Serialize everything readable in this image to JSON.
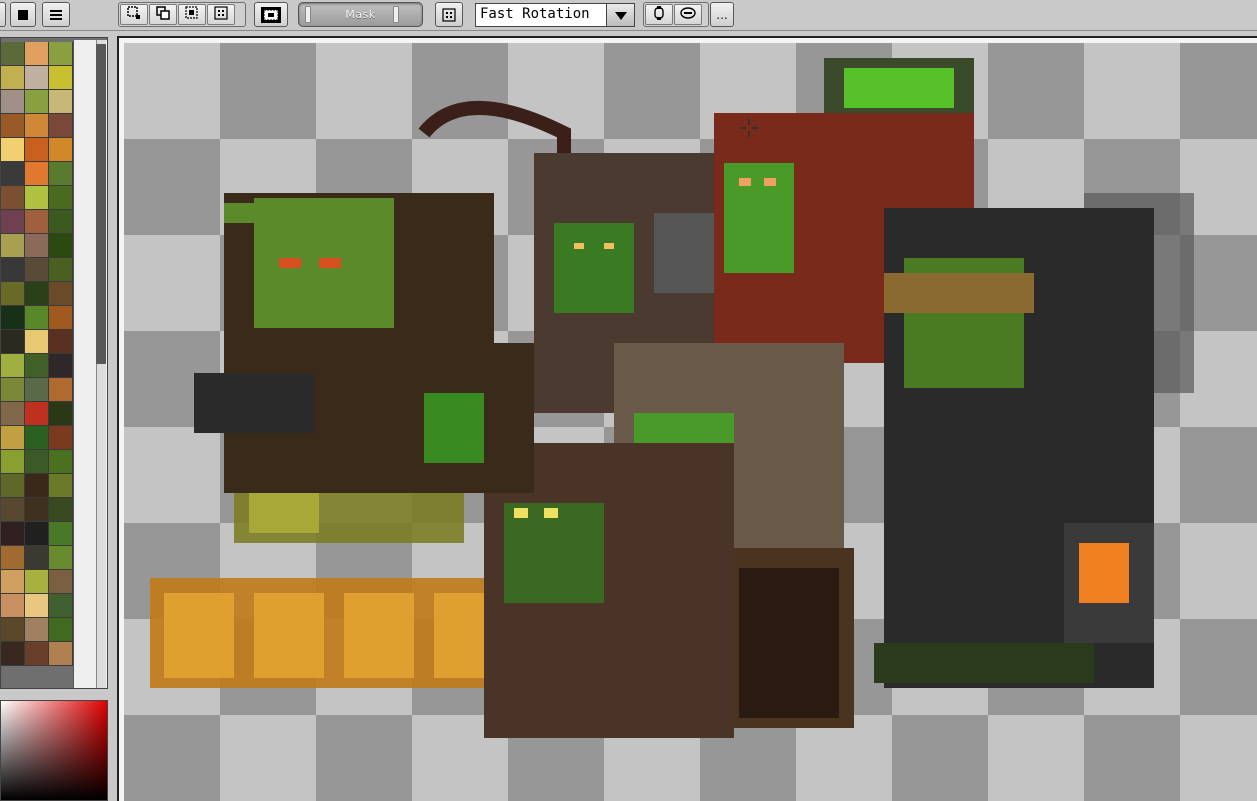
{
  "toolbar": {
    "mask_label": "Mask",
    "rotation_mode": "Fast Rotation",
    "more_label": "...",
    "icons": [
      "square-solid-icon",
      "list-icon",
      "select-rect-icon",
      "duplicate-icon",
      "select-lasso-icon",
      "grid-dots-icon",
      "selection-marquee-icon",
      "mask-slider",
      "grid-icon",
      "dropdown-arrow-icon",
      "transform-icon",
      "link-icon",
      "more-icon"
    ]
  },
  "palette": {
    "swatches": [
      "#5a6a3a",
      "#e0a060",
      "#8aa040",
      "#c0b050",
      "#c0b0a0",
      "#c8c030",
      "#a09088",
      "#88a040",
      "#c8b878",
      "#9a5a28",
      "#d08838",
      "#7a4838",
      "#f0d070",
      "#c86020",
      "#d08828",
      "#3a3a3a",
      "#e07830",
      "#5a7a30",
      "#7a5030",
      "#b0c040",
      "#4a6a20",
      "#704050",
      "#a06040",
      "#3a5a20",
      "#a8a050",
      "#8a6a58",
      "#2a4a10",
      "#383838",
      "#5a4a38",
      "#4a6020",
      "#6a6a28",
      "#2a4018",
      "#6a4a28",
      "#183018",
      "#58882a",
      "#a05a20",
      "#2a2a20",
      "#e8c870",
      "#5a3020",
      "#a0b040",
      "#406028",
      "#302828",
      "#7a8838",
      "#5a6a48",
      "#b06a30",
      "#806848",
      "#c03020",
      "#2a3818",
      "#c0a040",
      "#2a6020",
      "#7a3a20",
      "#88a030",
      "#3a5a28",
      "#4a7020",
      "#606828",
      "#3a2818",
      "#6a7a28",
      "#584830",
      "#403020",
      "#3a4a20",
      "#302020",
      "#202020",
      "#487828",
      "#a06a30",
      "#3a3a30",
      "#6a8a30",
      "#d0a060",
      "#a8b040",
      "#7a6040",
      "#c89060",
      "#e8c880",
      "#406030",
      "#5a4828",
      "#a08060",
      "#406a20",
      "#382820",
      "#68402a",
      "#b08050"
    ]
  },
  "colors": {
    "toolbar_bg": "#c9c9c9",
    "checker_dark": "#979797",
    "checker_light": "#c4c4c4",
    "picker_hue": "#e00000"
  }
}
